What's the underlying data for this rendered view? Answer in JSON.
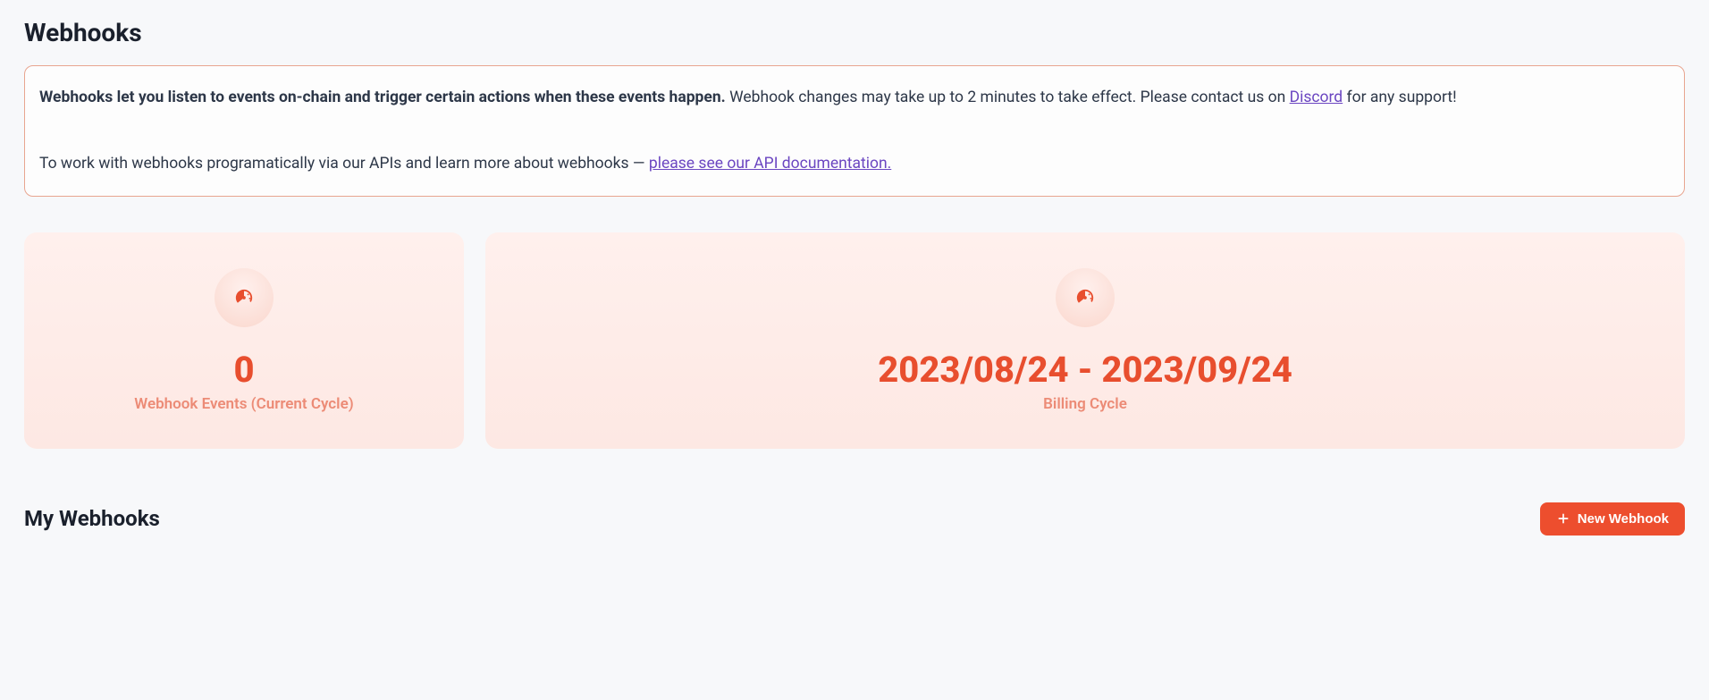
{
  "page": {
    "title": "Webhooks"
  },
  "banner": {
    "bold_text": "Webhooks let you listen to events on-chain and trigger certain actions when these events happen.",
    "text_after_bold": " Webhook changes may take up to 2 minutes to take effect. Please contact us on ",
    "discord_link": "Discord",
    "text_after_link": " for any support!",
    "secondary_text_prefix": "To work with webhooks programatically via our APIs and learn more about webhooks — ",
    "api_doc_link": "please see our API documentation."
  },
  "stats": {
    "events": {
      "value": "0",
      "label": "Webhook Events (Current Cycle)"
    },
    "billing": {
      "value": "2023/08/24 - 2023/09/24",
      "label": "Billing Cycle"
    }
  },
  "section": {
    "title": "My Webhooks",
    "new_button_label": "New Webhook"
  }
}
